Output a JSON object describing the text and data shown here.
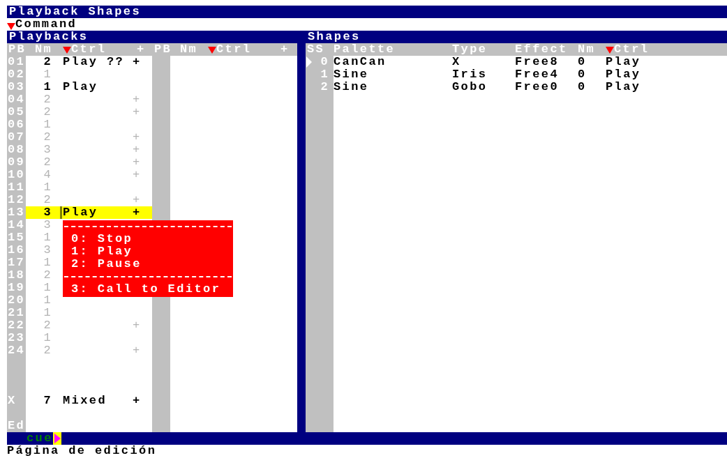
{
  "window": {
    "title": "Playback Shapes"
  },
  "command": {
    "label": "Command"
  },
  "playbacks": {
    "title": "Playbacks",
    "columns": [
      "PB",
      "Nm",
      "Ctrl",
      "+",
      "PB",
      "Nm",
      "Ctrl",
      "+"
    ],
    "rows": [
      {
        "pb": "01",
        "nm": "2",
        "ctrl": "Play ??",
        "plus": "+",
        "active": true,
        "selected": false
      },
      {
        "pb": "02",
        "nm": "1",
        "ctrl": "",
        "plus": "",
        "active": false,
        "selected": false
      },
      {
        "pb": "03",
        "nm": "1",
        "ctrl": "Play",
        "plus": "",
        "active": true,
        "selected": false
      },
      {
        "pb": "04",
        "nm": "2",
        "ctrl": "",
        "plus": "+",
        "active": false,
        "selected": false
      },
      {
        "pb": "05",
        "nm": "2",
        "ctrl": "",
        "plus": "+",
        "active": false,
        "selected": false
      },
      {
        "pb": "06",
        "nm": "1",
        "ctrl": "",
        "plus": "",
        "active": false,
        "selected": false
      },
      {
        "pb": "07",
        "nm": "2",
        "ctrl": "",
        "plus": "+",
        "active": false,
        "selected": false
      },
      {
        "pb": "08",
        "nm": "3",
        "ctrl": "",
        "plus": "+",
        "active": false,
        "selected": false
      },
      {
        "pb": "09",
        "nm": "2",
        "ctrl": "",
        "plus": "+",
        "active": false,
        "selected": false
      },
      {
        "pb": "10",
        "nm": "4",
        "ctrl": "",
        "plus": "+",
        "active": false,
        "selected": false
      },
      {
        "pb": "11",
        "nm": "1",
        "ctrl": "",
        "plus": "",
        "active": false,
        "selected": false
      },
      {
        "pb": "12",
        "nm": "2",
        "ctrl": "",
        "plus": "+",
        "active": false,
        "selected": false
      },
      {
        "pb": "13",
        "nm": "3",
        "ctrl": "Play",
        "plus": "+",
        "active": true,
        "selected": true
      },
      {
        "pb": "14",
        "nm": "3",
        "ctrl": "",
        "plus": "",
        "active": false,
        "selected": false
      },
      {
        "pb": "15",
        "nm": "1",
        "ctrl": "",
        "plus": "",
        "active": false,
        "selected": false
      },
      {
        "pb": "16",
        "nm": "3",
        "ctrl": "",
        "plus": "",
        "active": false,
        "selected": false
      },
      {
        "pb": "17",
        "nm": "1",
        "ctrl": "",
        "plus": "",
        "active": false,
        "selected": false
      },
      {
        "pb": "18",
        "nm": "2",
        "ctrl": "",
        "plus": "",
        "active": false,
        "selected": false
      },
      {
        "pb": "19",
        "nm": "1",
        "ctrl": "",
        "plus": "",
        "active": false,
        "selected": false
      },
      {
        "pb": "20",
        "nm": "1",
        "ctrl": "",
        "plus": "",
        "active": false,
        "selected": false
      },
      {
        "pb": "21",
        "nm": "1",
        "ctrl": "",
        "plus": "",
        "active": false,
        "selected": false
      },
      {
        "pb": "22",
        "nm": "2",
        "ctrl": "",
        "plus": "+",
        "active": false,
        "selected": false
      },
      {
        "pb": "23",
        "nm": "1",
        "ctrl": "",
        "plus": "",
        "active": false,
        "selected": false
      },
      {
        "pb": "24",
        "nm": "2",
        "ctrl": "",
        "plus": "+",
        "active": false,
        "selected": false
      }
    ],
    "mixed_row": {
      "pb": "X",
      "nm": "7",
      "ctrl": "Mixed",
      "plus": "+"
    },
    "edit_row": {
      "pb": "Ed"
    }
  },
  "ctrl_menu": {
    "items": [
      {
        "label": "0: Stop",
        "divider_before": true
      },
      {
        "label": "1: Play",
        "divider_before": false
      },
      {
        "label": "2: Pause",
        "divider_before": false
      },
      {
        "label": "3: Call to Editor",
        "divider_before": true
      }
    ]
  },
  "shapes": {
    "title": "Shapes",
    "columns": [
      "SS",
      "Palette",
      "Type",
      "Effect",
      "Nm",
      "Ctrl"
    ],
    "rows": [
      {
        "ss": "0",
        "palette": "CanCan",
        "type": "X",
        "effect": "Free8",
        "nm": "0",
        "ctrl": "Play",
        "selected": true
      },
      {
        "ss": "1",
        "palette": "Sine",
        "type": "Iris",
        "effect": "Free4",
        "nm": "0",
        "ctrl": "Play",
        "selected": false
      },
      {
        "ss": "2",
        "palette": "Sine",
        "type": "Gobo",
        "effect": "Free0",
        "nm": "0",
        "ctrl": "Play",
        "selected": false
      }
    ]
  },
  "prompt": {
    "label": "cue"
  },
  "status_bar": {
    "text": "Página de edición"
  }
}
